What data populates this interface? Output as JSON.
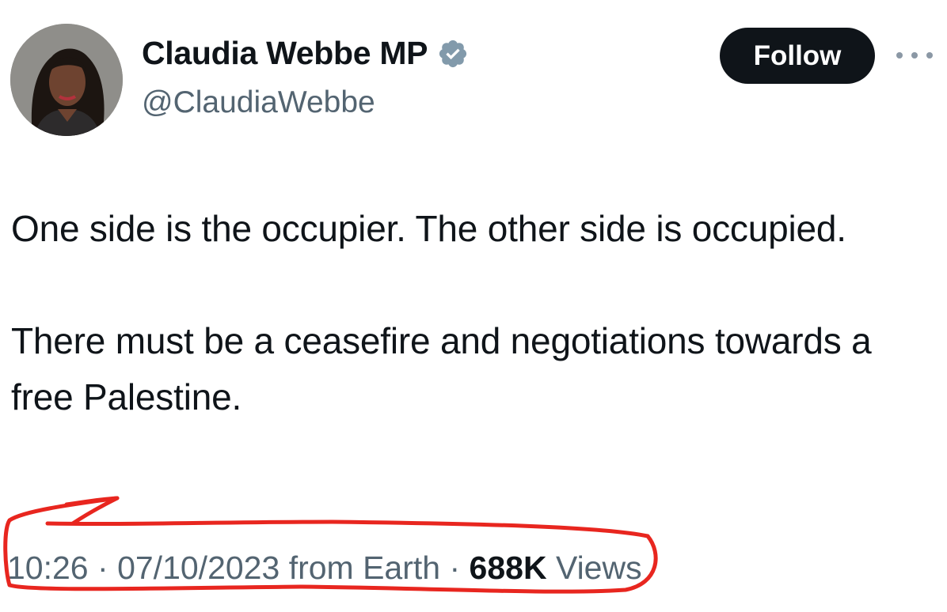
{
  "author": {
    "display_name": "Claudia Webbe MP",
    "handle": "@ClaudiaWebbe",
    "verified_icon": "verified-badge-icon",
    "verified_color": "#829aab"
  },
  "actions": {
    "follow_label": "Follow",
    "more_icon": "more-horizontal-icon"
  },
  "tweet": {
    "paragraphs": [
      "One side is the occupier. The other side is occupied.",
      "There must be a ceasefire and negotiations towards a free Palestine."
    ]
  },
  "meta": {
    "time": "10:26",
    "separator": "·",
    "date": "07/10/2023",
    "source": "from Earth",
    "views_count": "688K",
    "views_label": "Views"
  },
  "colors": {
    "text_primary": "#0f1419",
    "text_secondary": "#536471",
    "follow_bg": "#0f1419",
    "annotation_red": "#e8261f"
  }
}
